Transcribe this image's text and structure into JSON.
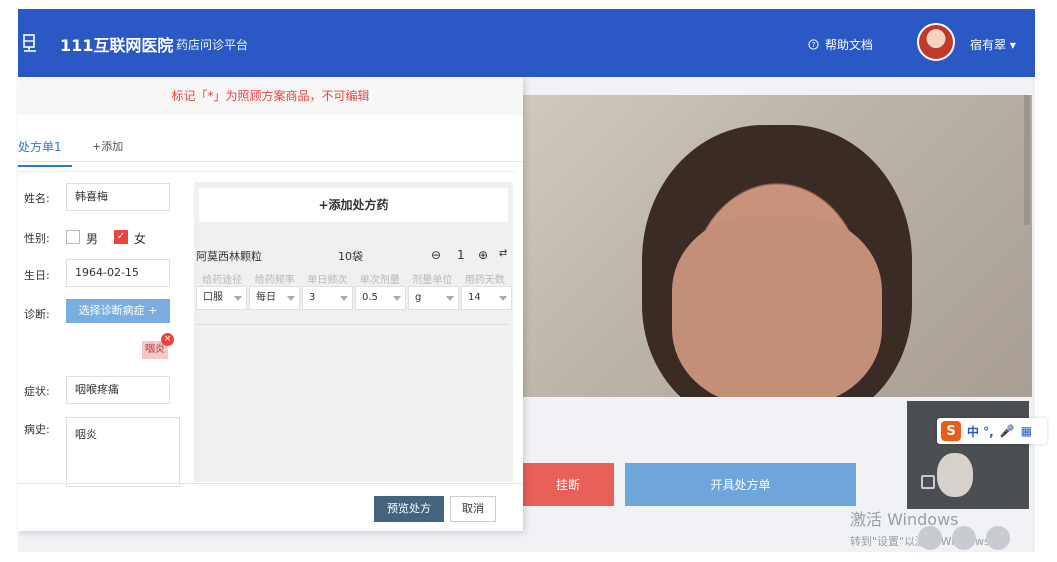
{
  "header": {
    "brand": "111互联网医院",
    "subtitle": "药店问诊平台",
    "help": "帮助文档",
    "user": "宿有翠"
  },
  "video": {
    "hangup": "挂断",
    "prescribe": "开具处方单",
    "ime_text": "中 °,"
  },
  "windows": {
    "line1": "激活 Windows",
    "line2": "转到\"设置\"以激活 Windows。"
  },
  "modal": {
    "notice": "标记「*」为照顾方案商品，不可编辑",
    "tab_active": "处方单1",
    "tab_add": "+添加",
    "name_label": "姓名:",
    "name_value": "韩喜梅",
    "gender_label": "性别:",
    "gender_male": "男",
    "gender_female": "女",
    "birth_label": "生日:",
    "birth_value": "1964-02-15",
    "diag_label": "诊断:",
    "diag_button": "选择诊断病症 +",
    "diag_tag": "咽炎",
    "symptom_label": "症状:",
    "symptom_value": "咽喉疼痛",
    "history_label": "病史:",
    "history_value": "咽炎",
    "add_drug": "+添加处方药",
    "drug": {
      "name": "阿莫西林颗粒",
      "qty": "10袋",
      "count": "1",
      "headers": [
        "给药途径",
        "给药频率",
        "单日频次",
        "单次剂量",
        "剂量单位",
        "用药天数"
      ],
      "values": [
        "口服",
        "每日",
        "3",
        "0.5",
        "g",
        "14"
      ]
    },
    "preview": "预览处方",
    "cancel": "取消"
  }
}
